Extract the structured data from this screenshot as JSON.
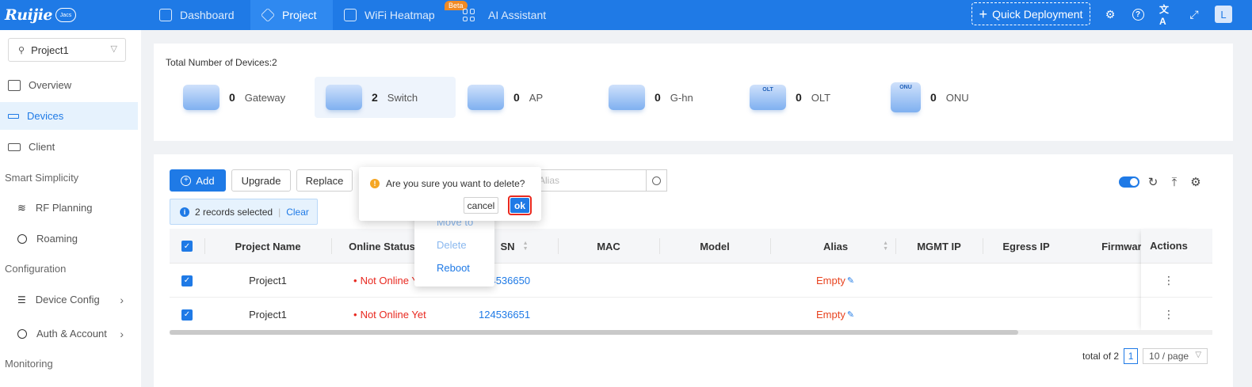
{
  "topbar": {
    "logo": "Ruijie",
    "logo_badge": "Jacs",
    "nav": [
      {
        "label": "Dashboard",
        "icon": "home-icon"
      },
      {
        "label": "Project",
        "icon": "cube-icon"
      },
      {
        "label": "WiFi Heatmap",
        "icon": "image-icon"
      },
      {
        "label": "AI Assistant",
        "icon": "grid-icon"
      }
    ],
    "beta_badge": "Beta",
    "quick_deployment": "Quick Deployment",
    "avatar_letter": "L"
  },
  "sidebar": {
    "project_select": "Project1",
    "items": [
      {
        "label": "Overview"
      },
      {
        "label": "Devices"
      },
      {
        "label": "Client"
      }
    ],
    "sections": {
      "smart_simplicity": "Smart Simplicity",
      "configuration": "Configuration",
      "monitoring": "Monitoring"
    },
    "smart_items": [
      {
        "label": "RF Planning"
      },
      {
        "label": "Roaming"
      }
    ],
    "config_items": [
      {
        "label": "Device Config"
      },
      {
        "label": "Auth & Account"
      }
    ]
  },
  "summary": {
    "total_label": "Total Number of Devices:2",
    "devices": [
      {
        "count": "0",
        "name": "Gateway",
        "img_label": ""
      },
      {
        "count": "2",
        "name": "Switch",
        "img_label": ""
      },
      {
        "count": "0",
        "name": "AP",
        "img_label": ""
      },
      {
        "count": "0",
        "name": "G-hn",
        "img_label": ""
      },
      {
        "count": "0",
        "name": "OLT",
        "img_label": "OLT"
      },
      {
        "count": "0",
        "name": "ONU",
        "img_label": "ONU"
      }
    ]
  },
  "toolbar": {
    "add": "Add",
    "upgrade": "Upgrade",
    "replace": "Replace",
    "search_placeholder": "Alias",
    "selected_text": "2 records selected",
    "clear": "Clear"
  },
  "table": {
    "columns": [
      "Project Name",
      "Online Status",
      "SN",
      "MAC",
      "Model",
      "Alias",
      "MGMT IP",
      "Egress IP",
      "Firmware",
      "Actions"
    ],
    "rows": [
      {
        "project": "Project1",
        "status": "Not Online Yet",
        "sn": "124536650",
        "alias": "Empty"
      },
      {
        "project": "Project1",
        "status": "Not Online Yet",
        "sn": "124536651",
        "alias": "Empty"
      }
    ]
  },
  "pagination": {
    "total": "total of 2",
    "page": "1",
    "page_size": "10 / page"
  },
  "menu": {
    "items": [
      "Move to",
      "Delete",
      "Reboot"
    ]
  },
  "popconfirm": {
    "message": "Are you sure you want to delete?",
    "cancel": "cancel",
    "ok": "ok"
  },
  "colors": {
    "primary": "#1f7ae6",
    "danger": "#e8281f",
    "warning": "#f5a623"
  }
}
